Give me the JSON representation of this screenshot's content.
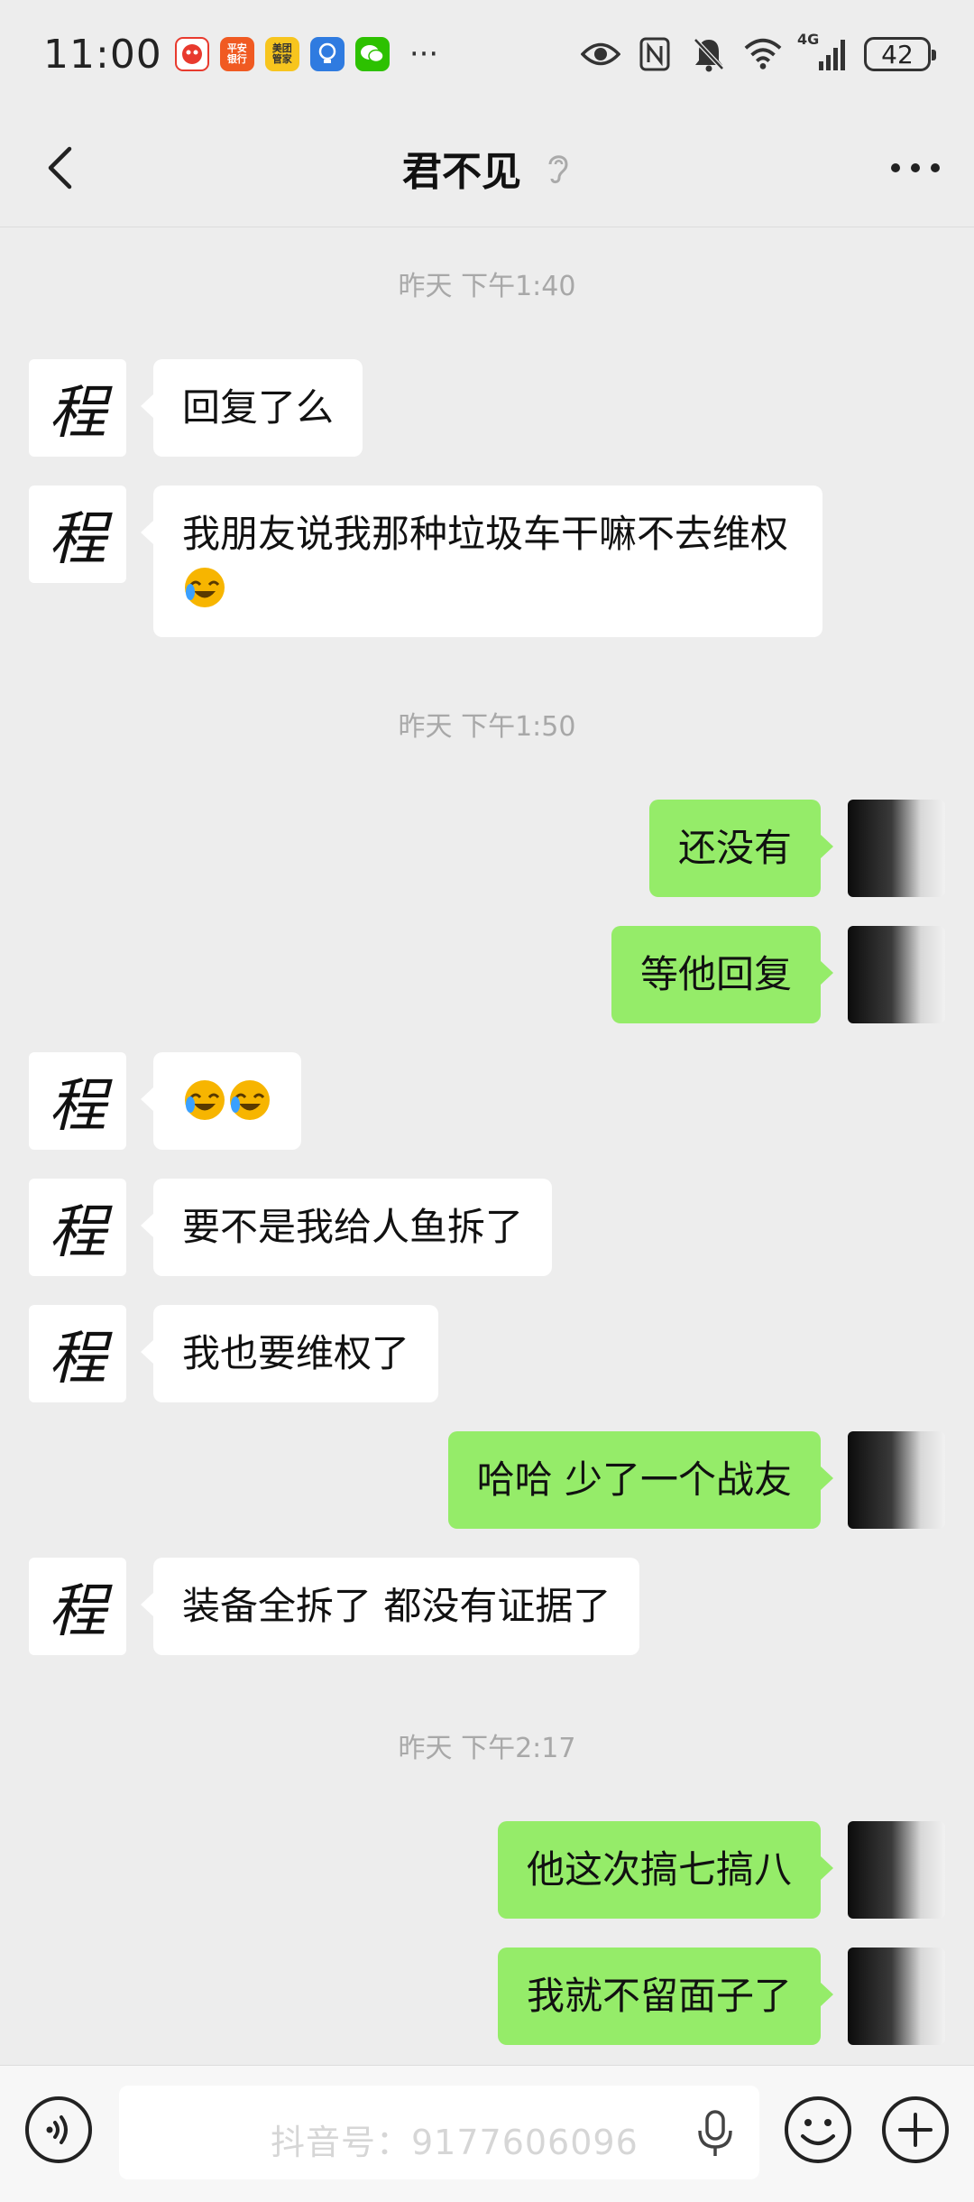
{
  "status_bar": {
    "time": "11:00",
    "apps": [
      {
        "name": "pdd-app-icon",
        "label": "",
        "color": "#e83a2e"
      },
      {
        "name": "pingan-bank-icon",
        "label": "平安\n银行",
        "color": "#f05a22"
      },
      {
        "name": "meituan-icon",
        "label": "美团\n管家",
        "color": "#f7c51e"
      },
      {
        "name": "lightbulb-app-icon",
        "label": "",
        "color": "#2f7be0"
      },
      {
        "name": "wechat-app-icon",
        "label": "",
        "color": "#2dc100"
      }
    ],
    "overflow": "···",
    "network": "4G",
    "battery": "42"
  },
  "header": {
    "title": "君不见"
  },
  "avatar_left_char": "程",
  "timestamps": [
    "昨天 下午1:40",
    "昨天 下午1:50",
    "昨天 下午2:17"
  ],
  "messages": [
    {
      "side": "in",
      "text": "回复了么"
    },
    {
      "side": "in",
      "text": "我朋友说我那种垃圾车干嘛不去维权"
    },
    {
      "side": "out",
      "text": "还没有"
    },
    {
      "side": "out",
      "text": "等他回复"
    },
    {
      "side": "in",
      "text": ""
    },
    {
      "side": "in",
      "text": "要不是我给人鱼拆了"
    },
    {
      "side": "in",
      "text": "我也要维权了"
    },
    {
      "side": "out",
      "text": "哈哈 少了一个战友"
    },
    {
      "side": "in",
      "text": "装备全拆了 都没有证据了"
    },
    {
      "side": "out",
      "text": "他这次搞七搞八"
    },
    {
      "side": "out",
      "text": "我就不留面子了"
    }
  ],
  "input": {
    "watermark": "抖音号：9177606096"
  },
  "colors": {
    "background": "#ededed",
    "bubble_out": "#95ec69",
    "bubble_in": "#ffffff"
  }
}
